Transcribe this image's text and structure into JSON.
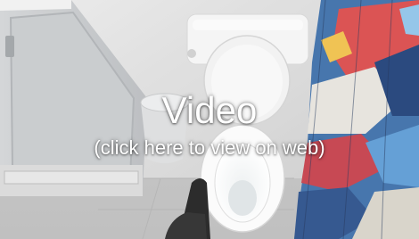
{
  "video": {
    "title": "Video",
    "subtitle": "(click here to view on web)",
    "poster_description": "bathroom toilet with colorful shower curtain"
  }
}
